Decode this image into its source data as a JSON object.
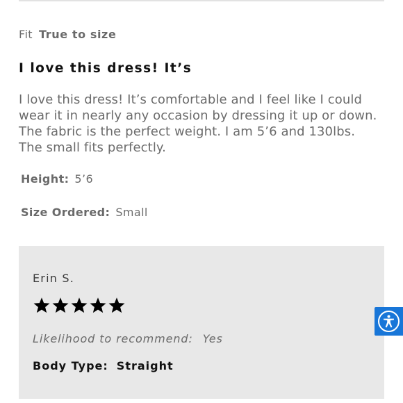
{
  "review": {
    "fit_label": "Fit",
    "fit_value": "True to size",
    "title": "I love this dress! It’s",
    "body_lines": [
      "I love this dress! It’s comfortable and I feel like I could",
      "wear it in nearly any occasion by dressing it up or down.",
      "The fabric is the perfect weight. I am 5’6 and 130lbs.",
      "The small fits perfectly."
    ],
    "height_label": "Height:",
    "height_value": "5’6",
    "size_label": "Size Ordered:",
    "size_value": "Small"
  },
  "reviewer": {
    "name": "Erin S.",
    "rating": 5,
    "rating_max": 5,
    "recommend_label": "Likelihood to recommend:",
    "recommend_value": "Yes",
    "body_type_label": "Body Type:",
    "body_type_value": "Straight"
  },
  "accessibility_widget": {
    "icon": "accessibility-person-icon",
    "color": "#1876d8"
  },
  "colors": {
    "card_background": "#e8e8e8",
    "star_fill": "#000000"
  }
}
